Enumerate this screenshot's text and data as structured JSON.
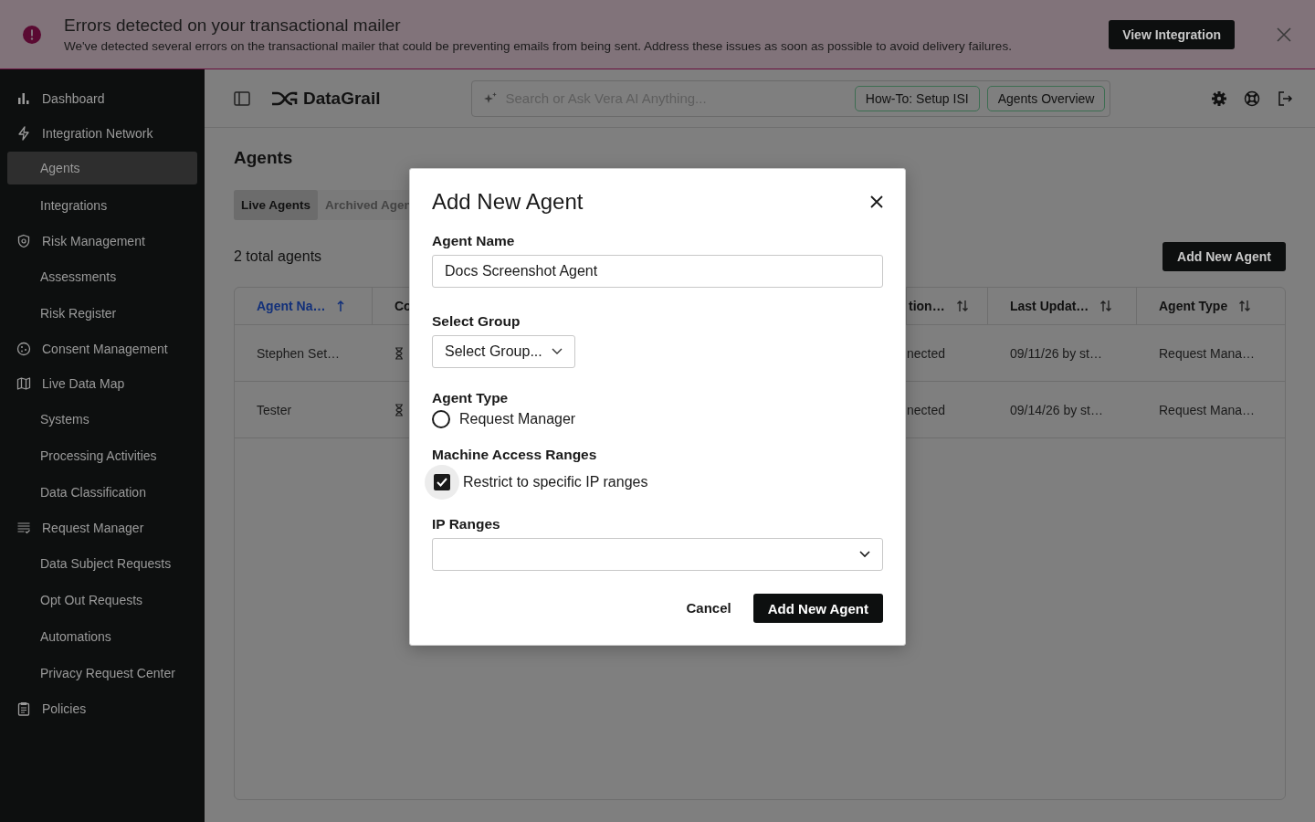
{
  "banner": {
    "title": "Errors detected on your transactional mailer",
    "message": "We've detected several errors on the transactional mailer that could be preventing emails from being sent. Address these issues as soon as possible to avoid delivery failures.",
    "action": "View Integration"
  },
  "sidebar": {
    "items": [
      {
        "label": "Dashboard",
        "kind": "chart",
        "selected": false
      },
      {
        "label": "Integration Network",
        "kind": "bolt",
        "selected": false,
        "children": [
          {
            "label": "Agents",
            "selected": true
          },
          {
            "label": "Integrations",
            "selected": false
          }
        ]
      },
      {
        "label": "Risk Management",
        "kind": "shield",
        "selected": false,
        "children": [
          {
            "label": "Assessments",
            "selected": false
          },
          {
            "label": "Risk Register",
            "selected": false
          }
        ]
      },
      {
        "label": "Consent Management",
        "kind": "cookie",
        "selected": false
      },
      {
        "label": "Live Data Map",
        "kind": "map",
        "selected": false,
        "children": [
          {
            "label": "Systems",
            "selected": false
          },
          {
            "label": "Processing Activities",
            "selected": false
          },
          {
            "label": "Data Classification",
            "selected": false
          }
        ]
      },
      {
        "label": "Request Manager",
        "kind": "list",
        "selected": false,
        "children": [
          {
            "label": "Data Subject Requests",
            "selected": false
          },
          {
            "label": "Opt Out Requests",
            "selected": false
          },
          {
            "label": "Automations",
            "selected": false
          },
          {
            "label": "Privacy Request Center",
            "selected": false
          }
        ]
      },
      {
        "label": "Policies",
        "kind": "clipboard",
        "selected": false
      }
    ]
  },
  "topbar": {
    "logo": "DataGrail",
    "search": {
      "placeholder": "Search or Ask Vera AI Anything..."
    },
    "chips": [
      "How-To: Setup ISI",
      "Agents Overview"
    ]
  },
  "page": {
    "title": "Agents",
    "tabs": [
      {
        "label": "Live Agents",
        "selected": true
      },
      {
        "label": "Archived Agen",
        "selected": false
      }
    ],
    "total": "2 total agents",
    "add_button": "Add New Agent",
    "table": {
      "columns": [
        {
          "label": "Agent Na…",
          "sorted": true
        },
        {
          "label": "Co"
        },
        {
          "label": "tion…",
          "sorted": false
        },
        {
          "label": "Last Updat…",
          "sorted": false
        },
        {
          "label": "Agent Type",
          "sorted": false
        }
      ],
      "rows": [
        {
          "agent_name": "Stephen Set…",
          "pending": true,
          "connection": "nected",
          "last_updated": "09/11/26 by st…",
          "agent_type": "Request Mana…"
        },
        {
          "agent_name": "Tester",
          "pending": true,
          "connection": "nected",
          "last_updated": "09/14/26 by st…",
          "agent_type": "Request Mana…"
        }
      ]
    }
  },
  "modal": {
    "title": "Add New Agent",
    "agent_name": {
      "label": "Agent Name",
      "value": "Docs Screenshot Agent"
    },
    "group": {
      "label": "Select Group",
      "value": "Select Group..."
    },
    "agent_type": {
      "label": "Agent Type",
      "options": [
        {
          "label": "Request Manager",
          "selected": false
        }
      ]
    },
    "access": {
      "label": "Machine Access Ranges",
      "option": {
        "label": "Restrict to specific IP ranges",
        "checked": true
      }
    },
    "ip_ranges": {
      "label": "IP Ranges"
    },
    "cancel": "Cancel",
    "submit": "Add New Agent"
  }
}
